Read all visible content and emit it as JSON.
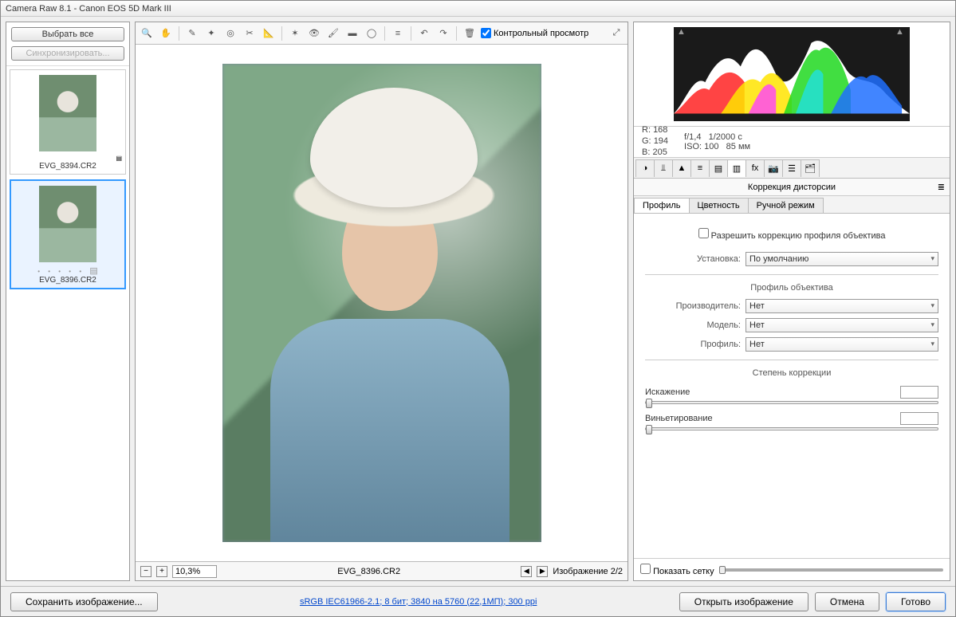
{
  "title": "Camera Raw 8.1  -  Canon EOS 5D Mark III",
  "left": {
    "select_all": "Выбрать все",
    "synchronize": "Синхронизировать...",
    "thumbs": [
      {
        "name": "EVG_8394.CR2"
      },
      {
        "name": "EVG_8396.CR2"
      }
    ]
  },
  "toolbar": {
    "preview_label": "Контрольный просмотр"
  },
  "status": {
    "zoom": "10,3%",
    "filename": "EVG_8396.CR2",
    "counter": "Изображение 2/2"
  },
  "info": {
    "r_label": "R:",
    "r": "168",
    "g_label": "G:",
    "g": "194",
    "b_label": "B:",
    "b": "205",
    "aperture": "f/1,4",
    "shutter": "1/2000 с",
    "iso_label": "ISO:",
    "iso": "100",
    "focal": "85 мм"
  },
  "panel": {
    "section_title": "Коррекция дисторсии",
    "tabs": {
      "profile": "Профиль",
      "color": "Цветность",
      "manual": "Ручной режим"
    },
    "enable_label": "Разрешить коррекцию профиля объектива",
    "setup_label": "Установка:",
    "setup_value": "По умолчанию",
    "lens_head": "Профиль объектива",
    "maker_label": "Производитель:",
    "maker_value": "Нет",
    "model_label": "Модель:",
    "model_value": "Нет",
    "profile_label": "Профиль:",
    "profile_value": "Нет",
    "amount_head": "Степень коррекции",
    "distortion": "Искажение",
    "vignette": "Виньетирование",
    "show_grid": "Показать сетку"
  },
  "footer": {
    "save": "Сохранить изображение...",
    "link": "sRGB IEC61966-2.1; 8 бит; 3840 на 5760 (22,1МП); 300 ppi",
    "open": "Открыть изображение",
    "cancel": "Отмена",
    "done": "Готово"
  }
}
